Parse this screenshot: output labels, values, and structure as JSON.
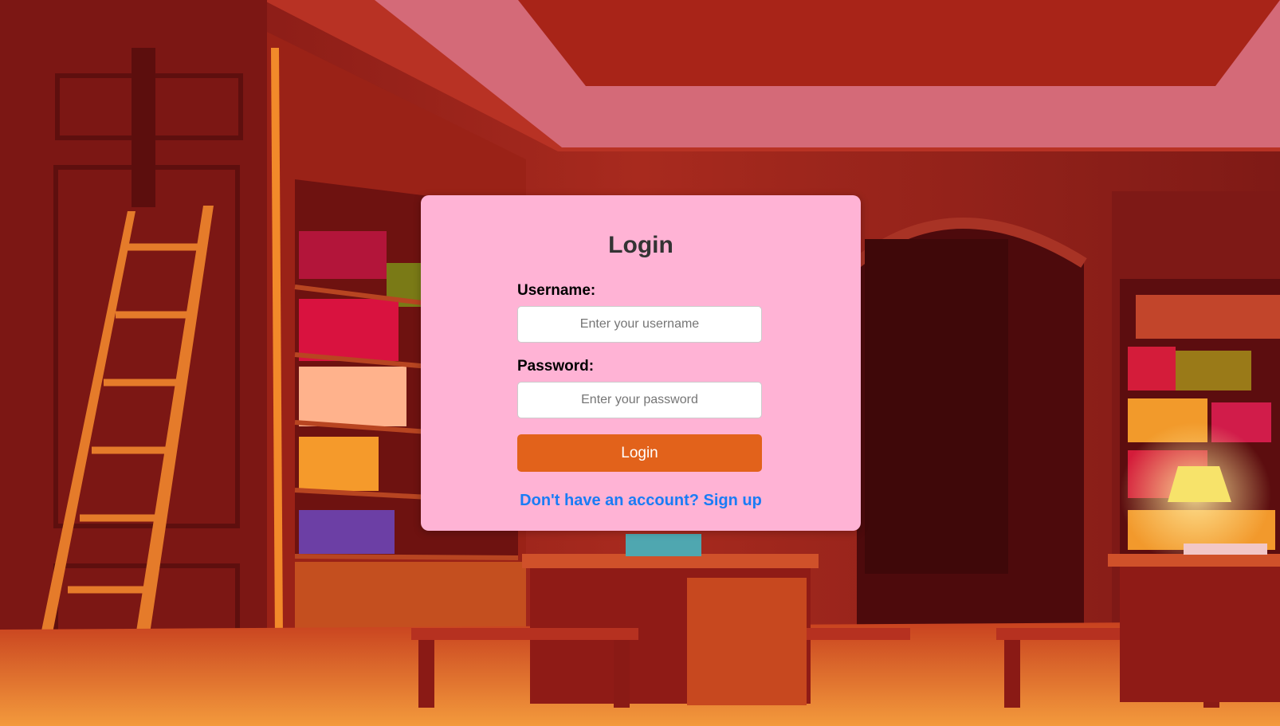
{
  "login": {
    "title": "Login",
    "username_label": "Username:",
    "username_placeholder": "Enter your username",
    "password_label": "Password:",
    "password_placeholder": "Enter your password",
    "submit_label": "Login",
    "signup_link": "Don't have an account? Sign up"
  },
  "colors": {
    "card_background": "#ffb3d5",
    "button": "#e2621b",
    "link": "#1a7cf5",
    "title_text": "#333333"
  },
  "icons": [
    "library-background-illustration"
  ]
}
